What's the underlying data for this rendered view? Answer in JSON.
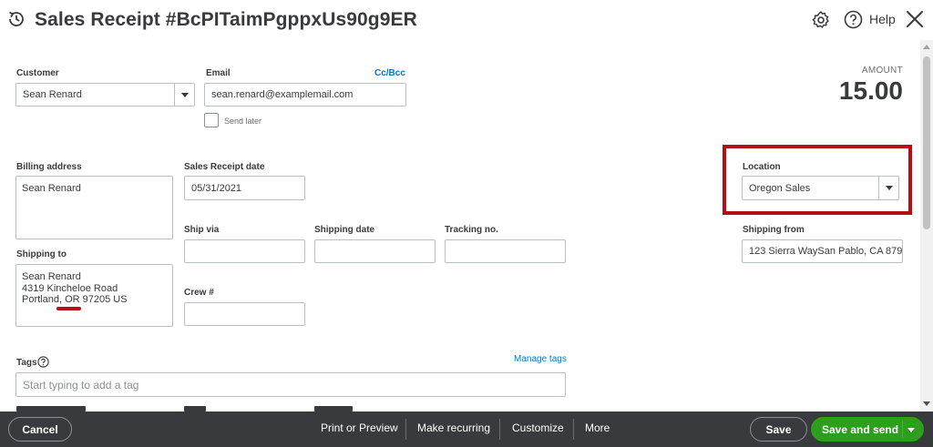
{
  "header": {
    "title": "Sales Receipt #BcPITaimPgppxUs90g9ER",
    "help_label": "Help",
    "icons": [
      "history-icon",
      "gear-icon",
      "help-icon",
      "close-icon"
    ]
  },
  "customer": {
    "label": "Customer",
    "value": "Sean Renard"
  },
  "email": {
    "label": "Email",
    "value": "sean.renard@examplemail.com",
    "cc_bcc": "Cc/Bcc",
    "send_later": "Send later"
  },
  "amount": {
    "label": "AMOUNT",
    "value": "15.00"
  },
  "billing": {
    "label": "Billing address",
    "value": "Sean Renard"
  },
  "receipt_date": {
    "label": "Sales Receipt date",
    "value": "05/31/2021"
  },
  "location": {
    "label": "Location",
    "value": "Oregon Sales"
  },
  "ship_via": {
    "label": "Ship via",
    "value": ""
  },
  "shipping_date": {
    "label": "Shipping date",
    "value": ""
  },
  "tracking": {
    "label": "Tracking no.",
    "value": ""
  },
  "shipping_from": {
    "label": "Shipping from",
    "value": "123 Sierra WaySan Pablo, CA  879"
  },
  "shipping_to": {
    "label": "Shipping to",
    "lines": [
      "Sean Renard",
      "4319 Kincheloe Road",
      "Portland, OR  97205 US"
    ]
  },
  "crew": {
    "label": "Crew #",
    "value": ""
  },
  "tags": {
    "label": "Tags",
    "manage": "Manage tags",
    "placeholder": "Start typing to add a tag"
  },
  "footer": {
    "cancel": "Cancel",
    "print_preview": "Print or Preview",
    "make_recurring": "Make recurring",
    "customize": "Customize",
    "more": "More",
    "save": "Save",
    "save_and_send": "Save and send"
  },
  "colors": {
    "accent_green": "#2ca01c",
    "link_blue": "#0077c5",
    "highlight_red": "#b50e15",
    "footer_bg": "#393a3d"
  }
}
